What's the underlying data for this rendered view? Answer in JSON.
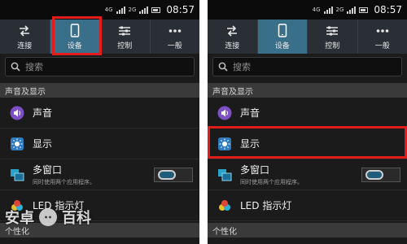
{
  "status": {
    "signal_a": "4G",
    "signal_b": "2G",
    "time": "08:57"
  },
  "quick_settings": [
    {
      "label": "连接",
      "icon": "connection-icon"
    },
    {
      "label": "设备",
      "icon": "device-icon"
    },
    {
      "label": "控制",
      "icon": "control-icon"
    },
    {
      "label": "一般",
      "icon": "more-icon"
    }
  ],
  "search": {
    "placeholder": "搜索"
  },
  "sections": {
    "sound_display": "声音及显示",
    "personalization": "个性化"
  },
  "items": {
    "sound": "声音",
    "display": "显示",
    "multiwindow": {
      "title": "多窗口",
      "subtitle": "同时使用两个应用程序。"
    },
    "led": "LED 指示灯"
  },
  "watermark": {
    "text_left": "安卓",
    "text_right": "百科"
  },
  "colors": {
    "highlight": "#e21b1b",
    "active_tile": "#3a6f8a",
    "background": "#1b1b1b"
  }
}
